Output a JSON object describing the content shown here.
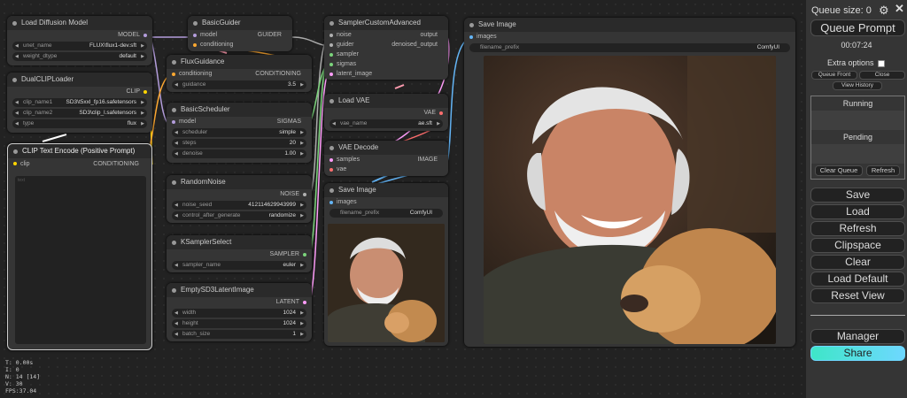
{
  "nodes": {
    "load_diffusion": {
      "title": "Load Diffusion Model",
      "out": "MODEL",
      "unet_label": "unet_name",
      "unet_value": "FLUX\\flux1-dev.sft",
      "dtype_label": "weight_dtype",
      "dtype_value": "default"
    },
    "dual_clip": {
      "title": "DualCLIPLoader",
      "out": "CLIP",
      "c1_label": "clip_name1",
      "c1_value": "SD3\\t5xxl_fp16.safetensors",
      "c2_label": "clip_name2",
      "c2_value": "SD3\\clip_l.safetensors",
      "type_label": "type",
      "type_value": "flux"
    },
    "clip_encode": {
      "title": "CLIP Text Encode (Positive Prompt)",
      "in": "clip",
      "out": "CONDITIONING",
      "placeholder": "text"
    },
    "basic_guider": {
      "title": "BasicGuider",
      "in1": "model",
      "in2": "conditioning",
      "out": "GUIDER"
    },
    "flux_guidance": {
      "title": "FluxGuidance",
      "in": "conditioning",
      "out": "CONDITIONING",
      "g_label": "guidance",
      "g_value": "3.5"
    },
    "basic_scheduler": {
      "title": "BasicScheduler",
      "in": "model",
      "out": "SIGMAS",
      "s_label": "scheduler",
      "s_value": "simple",
      "st_label": "steps",
      "st_value": "20",
      "d_label": "denoise",
      "d_value": "1.00"
    },
    "random_noise": {
      "title": "RandomNoise",
      "out": "NOISE",
      "seed_label": "noise_seed",
      "seed_value": "412114629943999",
      "ctrl_label": "control_after_generate",
      "ctrl_value": "randomize"
    },
    "ksampler_select": {
      "title": "KSamplerSelect",
      "out": "SAMPLER",
      "s_label": "sampler_name",
      "s_value": "euler"
    },
    "empty_latent": {
      "title": "EmptySD3LatentImage",
      "out": "LATENT",
      "w_label": "width",
      "w_value": "1024",
      "h_label": "height",
      "h_value": "1024",
      "b_label": "batch_size",
      "b_value": "1"
    },
    "sampler_custom": {
      "title": "SamplerCustomAdvanced",
      "in1": "noise",
      "in2": "guider",
      "in3": "sampler",
      "in4": "sigmas",
      "in5": "latent_image",
      "out1": "output",
      "out2": "denoised_output"
    },
    "load_vae": {
      "title": "Load VAE",
      "out": "VAE",
      "v_label": "vae_name",
      "v_value": "ae.sft"
    },
    "vae_decode": {
      "title": "VAE Decode",
      "in1": "samples",
      "in2": "vae",
      "out": "IMAGE"
    },
    "save_small": {
      "title": "Save Image",
      "in": "images",
      "p_label": "filename_prefix",
      "p_value": "ComfyUI"
    },
    "save_large": {
      "title": "Save Image",
      "in": "images",
      "p_label": "filename_prefix",
      "p_value": "ComfyUI"
    }
  },
  "stats": {
    "t": "T: 0.00s",
    "i": "I: 0",
    "n": "N: 14 [14]",
    "v": "V: 30",
    "fps": "FPS:37.04"
  },
  "menu": {
    "queue_size": "Queue size: 0",
    "queue_prompt": "Queue Prompt",
    "timer": "00:07:24",
    "extra_options": "Extra options",
    "queue_front": "Queue Front",
    "close": "Close",
    "view_history": "View History",
    "running": "Running",
    "pending": "Pending",
    "clear_queue": "Clear Queue",
    "refresh_small": "Refresh",
    "save": "Save",
    "load": "Load",
    "refresh": "Refresh",
    "clipspace": "Clipspace",
    "clear": "Clear",
    "load_default": "Load Default",
    "reset_view": "Reset View",
    "manager": "Manager",
    "share": "Share"
  },
  "icons": [
    "gear-icon",
    "close-icon"
  ]
}
